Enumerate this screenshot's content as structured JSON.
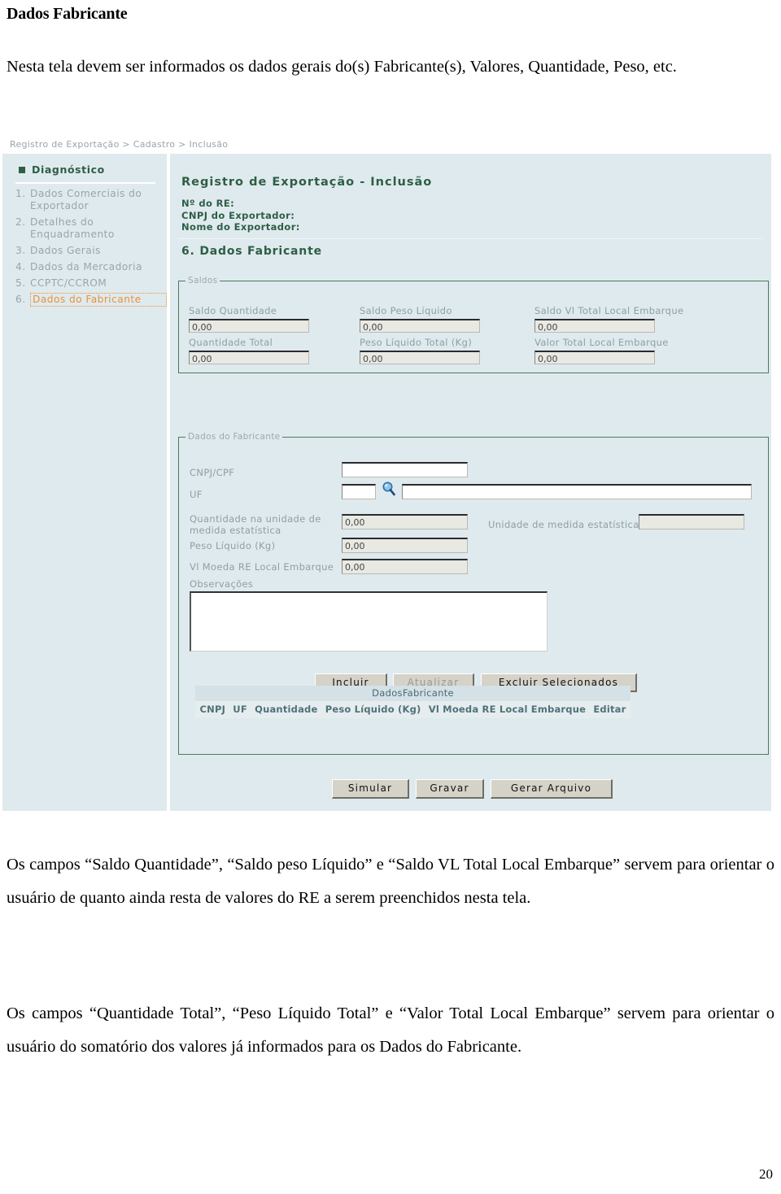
{
  "document": {
    "title": "Dados Fabricante",
    "intro": "Nesta tela devem ser informados os dados gerais do(s) Fabricante(s), Valores, Quantidade, Peso, etc.",
    "para1": "Os campos “Saldo Quantidade”, “Saldo peso Líquido” e “Saldo VL Total Local Embarque” servem para orientar o usuário de quanto ainda resta de valores do RE a serem preenchidos nesta tela.",
    "para2": "Os campos “Quantidade Total”, “Peso Líquido Total” e “Valor Total Local Embarque” servem para orientar o usuário do somatório dos valores já informados para os Dados do Fabricante.",
    "page_number": "20"
  },
  "app": {
    "breadcrumb": "Registro de Exportação > Cadastro > Inclusão",
    "sidebar": {
      "diagnostic_label": "Diagnóstico",
      "items": [
        {
          "num": "1.",
          "label": "Dados Comerciais do Exportador",
          "active": false
        },
        {
          "num": "2.",
          "label": "Detalhes do Enquadramento",
          "active": false
        },
        {
          "num": "3.",
          "label": "Dados Gerais",
          "active": false
        },
        {
          "num": "4.",
          "label": "Dados da Mercadoria",
          "active": false
        },
        {
          "num": "5.",
          "label": "CCPTC/CCROM",
          "active": false
        },
        {
          "num": "6.",
          "label": "Dados do Fabricante",
          "active": true
        }
      ]
    },
    "header": {
      "title": "Registro de Exportação - Inclusão",
      "re_number_label": "Nº do RE:",
      "re_number_value": "",
      "cnpj_exportador_label": "CNPJ do Exportador:",
      "cnpj_exportador_value": "",
      "nome_exportador_label": "Nome do Exportador:",
      "nome_exportador_value": "",
      "section_title": "6. Dados Fabricante"
    },
    "saldos": {
      "legend": "Saldos",
      "fields": [
        {
          "label": "Saldo Quantidade",
          "value": "0,00"
        },
        {
          "label": "Saldo Peso Líquido",
          "value": "0,00"
        },
        {
          "label": "Saldo Vl Total Local Embarque",
          "value": "0,00"
        },
        {
          "label": "Quantidade Total",
          "value": "0,00"
        },
        {
          "label": "Peso Líquido Total (Kg)",
          "value": "0,00"
        },
        {
          "label": "Valor Total Local Embarque",
          "value": "0,00"
        }
      ]
    },
    "fabricante": {
      "legend": "Dados do Fabricante",
      "cnpj_cpf_label": "CNPJ/CPF",
      "cnpj_cpf_value": "",
      "uf_label": "UF",
      "uf_value": "",
      "uf_name_value": "",
      "search_icon": "magnifier-icon",
      "qtd_label": "Quantidade na unidade de medida estatística",
      "qtd_value": "0,00",
      "unidade_label": "Unidade de medida estatística",
      "unidade_value": "",
      "peso_label": "Peso Líquido (Kg)",
      "peso_value": "0,00",
      "vl_moeda_label": "Vl Moeda RE Local Embarque",
      "vl_moeda_value": "0,00",
      "obs_label": "Observações",
      "obs_value": "",
      "buttons": [
        {
          "label": "Incluir",
          "disabled": false
        },
        {
          "label": "Atualizar",
          "disabled": true
        },
        {
          "label": "Excluir Selecionados",
          "disabled": false
        }
      ],
      "grid": {
        "caption": "DadosFabricante",
        "columns": [
          "CNPJ",
          "UF",
          "Quantidade",
          "Peso Líquido (Kg)",
          "Vl Moeda RE Local Embarque",
          "Editar"
        ],
        "rows": []
      }
    },
    "footer_buttons": [
      {
        "label": "Simular"
      },
      {
        "label": "Gravar"
      },
      {
        "label": "Gerar Arquivo"
      }
    ],
    "colors": {
      "panel_bg": "#dfeaee",
      "accent_green": "#2e5e44",
      "active_orange": "#e8923a",
      "label_gray": "#8e9fa4"
    }
  }
}
